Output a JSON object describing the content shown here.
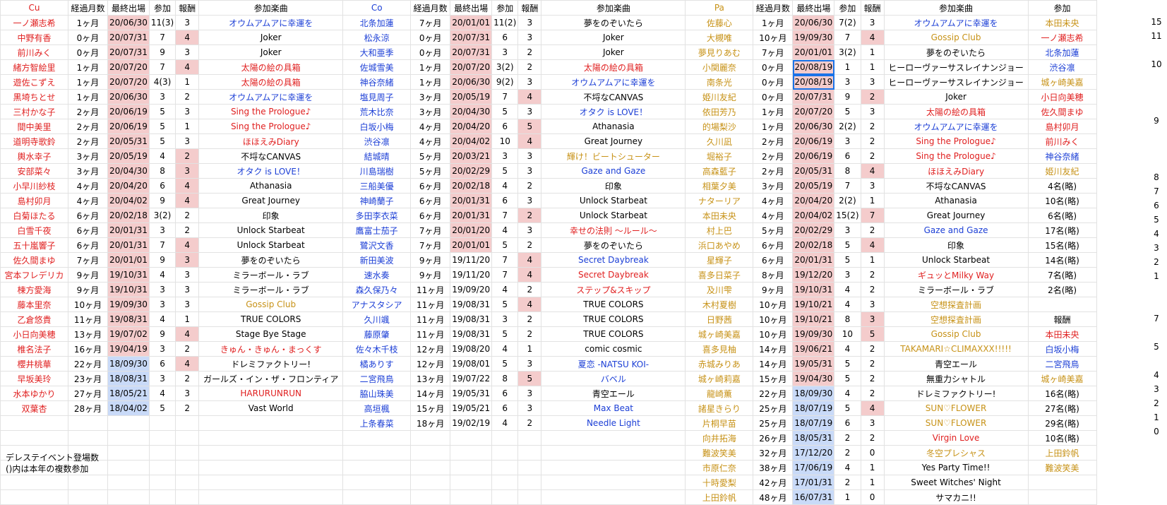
{
  "sheet": {
    "header": [
      "Cu",
      "経過月数",
      "最終出場",
      "参加",
      "報酬",
      "参加楽曲",
      "Co",
      "経過月数",
      "最終出場",
      "参加",
      "報酬",
      "参加楽曲",
      "Pa",
      "経過月数",
      "最終出場",
      "参加",
      "報酬",
      "参加楽曲",
      "参加"
    ],
    "rows": [
      [
        "一ノ瀬志希",
        "1ヶ月",
        "20/06/30",
        "11(3)",
        "3",
        "オウムアムアに幸運を",
        "北条加蓮",
        "7ヶ月",
        "20/01/01",
        "11(2)",
        "3",
        "夢をのぞいたら",
        "佐藤心",
        "1ヶ月",
        "20/06/30",
        "7(2)",
        "3",
        "オウムアムアに幸運を",
        "本田未央"
      ],
      [
        "中野有香",
        "0ヶ月",
        "20/07/31",
        "7",
        "4",
        "Joker",
        "松永涼",
        "0ヶ月",
        "20/07/31",
        "6",
        "3",
        "Joker",
        "大槻唯",
        "10ヶ月",
        "19/09/30",
        "7",
        "4",
        "Gossip Club",
        "一ノ瀬志希"
      ],
      [
        "前川みく",
        "0ヶ月",
        "20/07/31",
        "9",
        "3",
        "Joker",
        "大和亜季",
        "0ヶ月",
        "20/07/31",
        "3",
        "2",
        "Joker",
        "夢見りあむ",
        "7ヶ月",
        "20/01/01",
        "3(2)",
        "1",
        "夢をのぞいたら",
        "北条加蓮"
      ],
      [
        "緒方智絵里",
        "1ヶ月",
        "20/07/20",
        "7",
        "4",
        "太陽の絵の具箱",
        "佐城雪美",
        "1ヶ月",
        "20/07/20",
        "3(2)",
        "2",
        "太陽の絵の具箱",
        "小関麗奈",
        "0ヶ月",
        "20/08/19",
        "1",
        "1",
        "ヒーローヴァーサスレイナンジョー",
        "渋谷凛"
      ],
      [
        "遊佐こずえ",
        "1ヶ月",
        "20/07/20",
        "4(3)",
        "1",
        "太陽の絵の具箱",
        "神谷奈緒",
        "1ヶ月",
        "20/06/30",
        "9(2)",
        "3",
        "オウムアムアに幸運を",
        "南条光",
        "0ヶ月",
        "20/08/19",
        "3",
        "3",
        "ヒーローヴァーサスレイナンジョー",
        "城ヶ崎美嘉"
      ],
      [
        "黒埼ちとせ",
        "1ヶ月",
        "20/06/30",
        "3",
        "2",
        "オウムアムアに幸運を",
        "塩見周子",
        "3ヶ月",
        "20/05/19",
        "7",
        "4",
        "不埒なCANVAS",
        "姫川友紀",
        "0ヶ月",
        "20/07/31",
        "9",
        "2",
        "Joker",
        "小日向美穂"
      ],
      [
        "三村かな子",
        "2ヶ月",
        "20/06/19",
        "5",
        "3",
        "Sing the Prologue♪",
        "荒木比奈",
        "3ヶ月",
        "20/04/30",
        "5",
        "3",
        "オタク is LOVE！",
        "依田芳乃",
        "1ヶ月",
        "20/07/20",
        "5",
        "3",
        "太陽の絵の具箱",
        "佐久間まゆ"
      ],
      [
        "間中美里",
        "2ヶ月",
        "20/06/19",
        "5",
        "1",
        "Sing the Prologue♪",
        "白坂小梅",
        "4ヶ月",
        "20/04/20",
        "6",
        "5",
        "Athanasia",
        "的場梨沙",
        "1ヶ月",
        "20/06/30",
        "2(2)",
        "2",
        "オウムアムアに幸運を",
        "島村卯月"
      ],
      [
        "道明寺歌鈴",
        "2ヶ月",
        "20/05/31",
        "5",
        "3",
        "ほほえみDiary",
        "渋谷凛",
        "4ヶ月",
        "20/04/02",
        "10",
        "4",
        "Great Journey",
        "久川凪",
        "2ヶ月",
        "20/06/19",
        "3",
        "2",
        "Sing the Prologue♪",
        "前川みく"
      ],
      [
        "輿水幸子",
        "3ヶ月",
        "20/05/19",
        "4",
        "2",
        "不埒なCANVAS",
        "結城晴",
        "5ヶ月",
        "20/03/21",
        "3",
        "3",
        "輝け！ビートシューター",
        "堀裕子",
        "2ヶ月",
        "20/06/19",
        "6",
        "2",
        "Sing the Prologue♪",
        "神谷奈緒"
      ],
      [
        "安部菜々",
        "3ヶ月",
        "20/04/30",
        "8",
        "3",
        "オタク is LOVE！",
        "川島瑞樹",
        "5ヶ月",
        "20/02/29",
        "5",
        "3",
        "Gaze and Gaze",
        "高森藍子",
        "2ヶ月",
        "20/05/31",
        "8",
        "4",
        "ほほえみDiary",
        "姫川友紀"
      ],
      [
        "小早川紗枝",
        "4ヶ月",
        "20/04/20",
        "6",
        "4",
        "Athanasia",
        "三船美優",
        "6ヶ月",
        "20/02/18",
        "4",
        "2",
        "印象",
        "相葉夕美",
        "3ヶ月",
        "20/05/19",
        "7",
        "3",
        "不埒なCANVAS",
        "4名(略)"
      ],
      [
        "島村卯月",
        "4ヶ月",
        "20/04/02",
        "9",
        "4",
        "Great Journey",
        "神崎蘭子",
        "6ヶ月",
        "20/01/31",
        "6",
        "3",
        "Unlock Starbeat",
        "ナターリア",
        "4ヶ月",
        "20/04/20",
        "2(2)",
        "1",
        "Athanasia",
        "10名(略)"
      ],
      [
        "白菊ほたる",
        "6ヶ月",
        "20/02/18",
        "3(2)",
        "2",
        "印象",
        "多田李衣菜",
        "6ヶ月",
        "20/01/31",
        "7",
        "2",
        "Unlock Starbeat",
        "本田未央",
        "4ヶ月",
        "20/04/02",
        "15(2)",
        "7",
        "Great Journey",
        "6名(略)"
      ],
      [
        "白雪千夜",
        "6ヶ月",
        "20/01/31",
        "3",
        "2",
        "Unlock Starbeat",
        "鷹富士茄子",
        "7ヶ月",
        "20/01/20",
        "4",
        "3",
        "幸せの法則 ～ルール～",
        "村上巴",
        "5ヶ月",
        "20/02/29",
        "3",
        "2",
        "Gaze and Gaze",
        "17名(略)"
      ],
      [
        "五十嵐響子",
        "6ヶ月",
        "20/01/31",
        "7",
        "4",
        "Unlock Starbeat",
        "鷺沢文香",
        "7ヶ月",
        "20/01/01",
        "5",
        "2",
        "夢をのぞいたら",
        "浜口あやめ",
        "6ヶ月",
        "20/02/18",
        "5",
        "4",
        "印象",
        "15名(略)"
      ],
      [
        "佐久間まゆ",
        "7ヶ月",
        "20/01/01",
        "9",
        "3",
        "夢をのぞいたら",
        "新田美波",
        "9ヶ月",
        "19/11/20",
        "7",
        "4",
        "Secret Daybreak",
        "星輝子",
        "6ヶ月",
        "20/01/31",
        "5",
        "1",
        "Unlock Starbeat",
        "14名(略)"
      ],
      [
        "宮本フレデリカ",
        "9ヶ月",
        "19/10/31",
        "4",
        "3",
        "ミラーボール・ラブ",
        "速水奏",
        "9ヶ月",
        "19/11/20",
        "7",
        "4",
        "Secret Daybreak",
        "喜多日菜子",
        "8ヶ月",
        "19/12/20",
        "3",
        "2",
        "ギュッとMilky Way",
        "7名(略)"
      ],
      [
        "楝方愛海",
        "9ヶ月",
        "19/10/31",
        "3",
        "3",
        "ミラーボール・ラブ",
        "森久保乃々",
        "11ヶ月",
        "19/09/20",
        "4",
        "2",
        "ステップ&スキップ",
        "及川雫",
        "9ヶ月",
        "19/10/31",
        "4",
        "2",
        "ミラーボール・ラブ",
        "2名(略)"
      ],
      [
        "藤本里奈",
        "10ヶ月",
        "19/09/30",
        "3",
        "3",
        "Gossip Club",
        "アナスタシア",
        "11ヶ月",
        "19/08/31",
        "5",
        "4",
        "TRUE COLORS",
        "木村夏樹",
        "10ヶ月",
        "19/10/21",
        "4",
        "3",
        "空想探査計画",
        ""
      ],
      [
        "乙倉悠貴",
        "11ヶ月",
        "19/08/31",
        "4",
        "1",
        "TRUE COLORS",
        "久川颯",
        "11ヶ月",
        "19/08/31",
        "3",
        "2",
        "TRUE COLORS",
        "日野茜",
        "10ヶ月",
        "19/10/21",
        "8",
        "3",
        "空想探査計画",
        "報酬"
      ],
      [
        "小日向美穂",
        "13ヶ月",
        "19/07/02",
        "9",
        "4",
        "Stage Bye Stage",
        "藤原肇",
        "11ヶ月",
        "19/08/31",
        "5",
        "2",
        "TRUE COLORS",
        "城ヶ崎美嘉",
        "10ヶ月",
        "19/09/30",
        "10",
        "5",
        "Gossip Club",
        "本田未央"
      ],
      [
        "椎名法子",
        "16ヶ月",
        "19/04/19",
        "3",
        "2",
        "きゅん・きゅん・まっくす",
        "佐々木千枝",
        "12ヶ月",
        "19/08/20",
        "4",
        "1",
        "comic cosmic",
        "喜多見柚",
        "14ヶ月",
        "19/06/21",
        "4",
        "2",
        "TAKAMARI☆CLIMAXXX!!!!!",
        "白坂小梅"
      ],
      [
        "櫻井桃華",
        "22ヶ月",
        "18/09/30",
        "6",
        "4",
        "ドレミファクトリー!",
        "橘ありす",
        "12ヶ月",
        "19/08/01",
        "5",
        "3",
        "夏恋 -NATSU KOI-",
        "赤城みりあ",
        "14ヶ月",
        "19/05/31",
        "5",
        "2",
        "青空エール",
        "二宮飛鳥"
      ],
      [
        "早坂美玲",
        "23ヶ月",
        "18/08/31",
        "3",
        "2",
        "ガールズ・イン・ザ・フロンティア",
        "二宮飛鳥",
        "13ヶ月",
        "19/07/22",
        "8",
        "5",
        "バベル",
        "城ヶ崎莉嘉",
        "15ヶ月",
        "19/04/30",
        "5",
        "2",
        "無重力シャトル",
        "城ヶ崎美嘉"
      ],
      [
        "水本ゆかり",
        "27ヶ月",
        "18/05/21",
        "4",
        "3",
        "HARURUNRUN",
        "脇山珠美",
        "14ヶ月",
        "19/05/31",
        "6",
        "3",
        "青空エール",
        "龍崎薫",
        "22ヶ月",
        "18/09/30",
        "4",
        "2",
        "ドレミファクトリー!",
        "16名(略)"
      ],
      [
        "双葉杏",
        "28ヶ月",
        "18/04/02",
        "5",
        "2",
        "Vast World",
        "高垣楓",
        "15ヶ月",
        "19/05/21",
        "6",
        "3",
        "Max Beat",
        "諸星きらり",
        "25ヶ月",
        "18/07/19",
        "5",
        "4",
        "SUN♡FLOWER",
        "27名(略)"
      ],
      [
        "",
        "",
        "",
        "",
        "",
        "",
        "上条春菜",
        "18ヶ月",
        "19/02/19",
        "4",
        "2",
        "Needle Light",
        "片桐早苗",
        "25ヶ月",
        "18/07/19",
        "6",
        "3",
        "SUN♡FLOWER",
        "29名(略)"
      ],
      [
        "",
        "",
        "",
        "",
        "",
        "",
        "",
        "",
        "",
        "",
        "",
        "",
        "向井拓海",
        "26ヶ月",
        "18/05/31",
        "2",
        "2",
        "Virgin Love",
        "10名(略)"
      ],
      [
        "",
        "",
        "",
        "",
        "",
        "",
        "",
        "",
        "",
        "",
        "",
        "",
        "難波笑美",
        "32ヶ月",
        "17/12/20",
        "2",
        "0",
        "冬空プレシャス",
        "上田鈴帆"
      ],
      [
        "",
        "",
        "",
        "",
        "",
        "",
        "",
        "",
        "",
        "",
        "",
        "",
        "市原仁奈",
        "38ヶ月",
        "17/06/19",
        "4",
        "1",
        "Yes Party Time!!",
        "難波笑美"
      ],
      [
        "",
        "",
        "",
        "",
        "",
        "",
        "",
        "",
        "",
        "",
        "",
        "",
        "十時愛梨",
        "42ヶ月",
        "17/01/31",
        "2",
        "1",
        "Sweet Witches' Night",
        ""
      ],
      [
        "",
        "",
        "",
        "",
        "",
        "",
        "",
        "",
        "",
        "",
        "",
        "",
        "上田鈴帆",
        "48ヶ月",
        "16/07/31",
        "1",
        "0",
        "サマカニ!!",
        ""
      ]
    ],
    "col_s": [
      "15",
      "11",
      "",
      "10",
      "",
      "",
      "",
      "9",
      "",
      "",
      "",
      "8",
      "7",
      "6",
      "5",
      "4",
      "3",
      "2",
      "1",
      "",
      "",
      "7",
      "",
      "5",
      "",
      "4",
      "3",
      "2",
      "1",
      "0",
      "",
      "",
      ""
    ],
    "note_line1": "デレステイベント登場数",
    "note_line2": "()内は本年の複数参加",
    "colors": {
      "red": "#e02020",
      "blue": "#1c3fd6",
      "gold": "#c79217",
      "pink_fill": "#f4cccc",
      "blue_fill": "#c9daf8",
      "grid": "#e2e2e2"
    }
  }
}
